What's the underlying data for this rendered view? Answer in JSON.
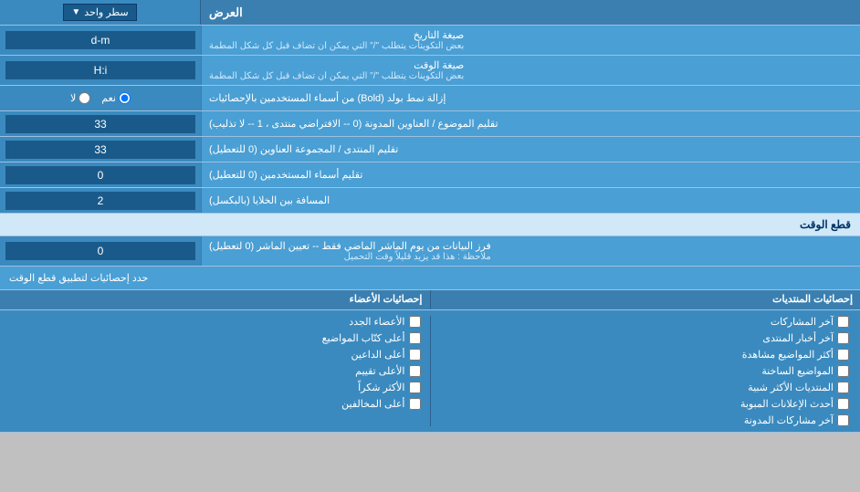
{
  "title": "العرض",
  "rows": [
    {
      "id": "display_mode",
      "label": "العرض",
      "input_type": "dropdown",
      "value": "سطر واحد"
    },
    {
      "id": "date_format",
      "label": "صيغة التاريخ",
      "sublabel": "بعض التكوينات يتطلب \"/\" التي يمكن ان تضاف قبل كل شكل المطمة",
      "input_type": "text",
      "value": "d-m"
    },
    {
      "id": "time_format",
      "label": "صيغة الوقت",
      "sublabel": "بعض التكوينات يتطلب \"/\" التي يمكن ان تضاف قبل كل شكل المطمة",
      "input_type": "text",
      "value": "H:i"
    },
    {
      "id": "bold_remove",
      "label": "إزالة نمط بولد (Bold) من أسماء المستخدمين بالإحصائيات",
      "input_type": "radio",
      "options": [
        "نعم",
        "لا"
      ],
      "selected": "نعم"
    },
    {
      "id": "topic_title_align",
      "label": "تقليم الموضوع / العناوين المدونة (0 -- الافتراضي منتدى ، 1 -- لا تذليب)",
      "input_type": "text",
      "value": "33"
    },
    {
      "id": "forum_title_align",
      "label": "تقليم المنتدى / المجموعة العناوين (0 للتعطيل)",
      "input_type": "text",
      "value": "33"
    },
    {
      "id": "username_trim",
      "label": "تقليم أسماء المستخدمين (0 للتعطيل)",
      "input_type": "text",
      "value": "0"
    },
    {
      "id": "cell_spacing",
      "label": "المسافة بين الخلايا (بالبكسل)",
      "input_type": "text",
      "value": "2"
    }
  ],
  "realtime_section": {
    "title": "قطع الوقت",
    "rows": [
      {
        "id": "realtime_days",
        "label": "فرز البيانات من يوم الماشر الماضي فقط -- تعيين الماشر (0 لتعطيل)",
        "note": "ملاحظة : هذا قد يزيد قليلاً وقت التحميل",
        "input_type": "text",
        "value": "0"
      }
    ],
    "apply_label": "حدد إحصائيات لتطبيق قطع الوقت",
    "col1_title": "إحصائيات المنتديات",
    "col2_title": "إحصائيات الأعضاء",
    "col1_items": [
      {
        "label": "آخر المشاركات",
        "checked": false
      },
      {
        "label": "آخر أخبار المنتدى",
        "checked": false
      },
      {
        "label": "أكثر المواضيع مشاهدة",
        "checked": false
      },
      {
        "label": "المواضيع الساخنة",
        "checked": false
      },
      {
        "label": "المنتديات الأكثر شبية",
        "checked": false
      },
      {
        "label": "أحدث الإعلانات المبوبة",
        "checked": false
      },
      {
        "label": "آخر مشاركات المدونة",
        "checked": false
      }
    ],
    "col2_items": [
      {
        "label": "الأعضاء الجدد",
        "checked": false
      },
      {
        "label": "أعلى كتّاب المواضيع",
        "checked": false
      },
      {
        "label": "أعلى الداعين",
        "checked": false
      },
      {
        "label": "الأعلى تقييم",
        "checked": false
      },
      {
        "label": "الأكثر شكراً",
        "checked": false
      },
      {
        "label": "أعلى المخالفين",
        "checked": false
      }
    ]
  }
}
